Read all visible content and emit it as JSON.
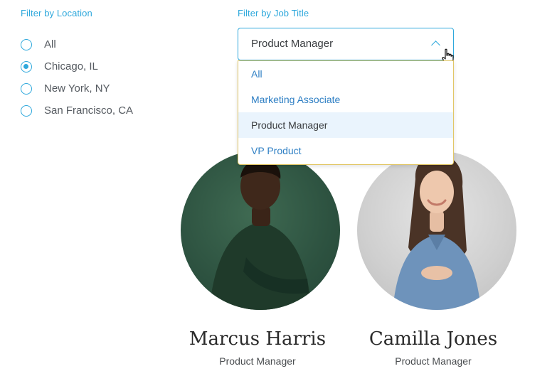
{
  "filters": {
    "location": {
      "label": "Filter by Location",
      "options": [
        {
          "label": "All",
          "checked": false
        },
        {
          "label": "Chicago, IL",
          "checked": true
        },
        {
          "label": "New York, NY",
          "checked": false
        },
        {
          "label": "San Francisco, CA",
          "checked": false
        }
      ]
    },
    "job_title": {
      "label": "Filter by Job Title",
      "selected": "Product Manager",
      "options": [
        {
          "label": "All",
          "selected": false
        },
        {
          "label": "Marketing Associate",
          "selected": false
        },
        {
          "label": "Product Manager",
          "selected": true
        },
        {
          "label": "VP Product",
          "selected": false
        }
      ]
    }
  },
  "people": [
    {
      "name": "Marcus Harris",
      "title": "Product Manager",
      "avatar": "person-photo"
    },
    {
      "name": "Camilla Jones",
      "title": "Product Manager",
      "avatar": "person-photo"
    }
  ],
  "colors": {
    "accent": "#2ea8dc",
    "link": "#2e7fc4",
    "selected_bg": "#eaf4fd"
  }
}
